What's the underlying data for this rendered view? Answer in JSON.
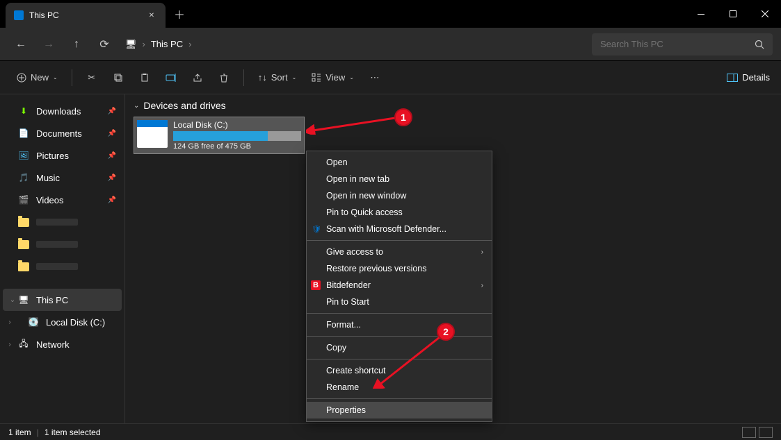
{
  "titlebar": {
    "tab_title": "This PC"
  },
  "address": {
    "crumb1": "This PC"
  },
  "search": {
    "placeholder": "Search This PC"
  },
  "toolbar": {
    "new_label": "New",
    "sort_label": "Sort",
    "view_label": "View",
    "details_label": "Details"
  },
  "sidebar": {
    "quick": [
      {
        "label": "Downloads",
        "icon": "⬇",
        "color": "#7cfc00"
      },
      {
        "label": "Documents",
        "icon": "📄",
        "color": "#ccc"
      },
      {
        "label": "Pictures",
        "icon": "🖼",
        "color": "#4fc3f7"
      },
      {
        "label": "Music",
        "icon": "🎵",
        "color": "#ff7043"
      },
      {
        "label": "Videos",
        "icon": "🎬",
        "color": "#7e57c2"
      }
    ],
    "tree": [
      {
        "label": "This PC",
        "icon": "🖥",
        "chev": "⌄",
        "selected": true
      },
      {
        "label": "Local Disk (C:)",
        "icon": "💽",
        "chev": "›",
        "indent": 1
      },
      {
        "label": "Network",
        "icon": "🖧",
        "chev": "›"
      }
    ]
  },
  "content": {
    "section_title": "Devices and drives",
    "drive": {
      "name": "Local Disk (C:)",
      "free_text": "124 GB free of 475 GB"
    }
  },
  "context_menu": {
    "items": [
      {
        "label": "Open"
      },
      {
        "label": "Open in new tab"
      },
      {
        "label": "Open in new window"
      },
      {
        "label": "Pin to Quick access"
      },
      {
        "label": "Scan with Microsoft Defender...",
        "icon": "🛡",
        "icon_color": "#0078d4"
      },
      {
        "sep": true
      },
      {
        "label": "Give access to",
        "sub": true
      },
      {
        "label": "Restore previous versions"
      },
      {
        "label": "Bitdefender",
        "sub": true,
        "icon": "B",
        "icon_bg": "#e81123"
      },
      {
        "label": "Pin to Start"
      },
      {
        "sep": true
      },
      {
        "label": "Format..."
      },
      {
        "sep": true
      },
      {
        "label": "Copy"
      },
      {
        "sep": true
      },
      {
        "label": "Create shortcut"
      },
      {
        "label": "Rename"
      },
      {
        "sep": true
      },
      {
        "label": "Properties",
        "hover": true
      }
    ]
  },
  "annotations": {
    "badge1": "1",
    "badge2": "2"
  },
  "status": {
    "items": "1 item",
    "selected": "1 item selected"
  }
}
